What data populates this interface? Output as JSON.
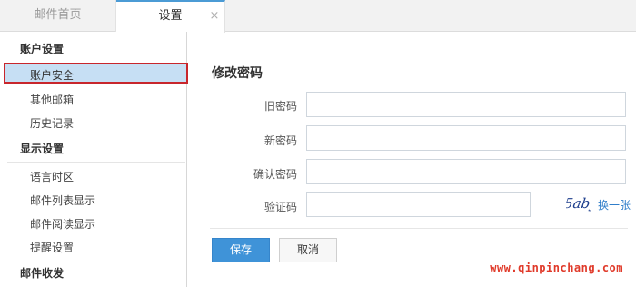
{
  "tabs": {
    "home": "邮件首页",
    "settings": "设置",
    "close_glyph": "×"
  },
  "sidebar": {
    "sections": [
      {
        "title": "账户设置",
        "items": [
          "账户安全",
          "其他邮箱",
          "历史记录"
        ]
      },
      {
        "title": "显示设置",
        "items": [
          "语言时区",
          "邮件列表显示",
          "邮件阅读显示",
          "提醒设置"
        ]
      },
      {
        "title": "邮件收发",
        "items": []
      }
    ],
    "active_item": "账户安全"
  },
  "form": {
    "heading": "修改密码",
    "old_password_label": "旧密码",
    "new_password_label": "新密码",
    "confirm_password_label": "确认密码",
    "captcha_label": "验证码",
    "captcha_text": "5aby",
    "refresh_label": "换一张",
    "save_label": "保存",
    "cancel_label": "取消"
  },
  "watermark": "www.qinpinchang.com",
  "colors": {
    "accent": "#3f93d8",
    "active_bg": "#c6dff4",
    "highlight_border": "#c8262c",
    "watermark": "#e03a2a"
  }
}
